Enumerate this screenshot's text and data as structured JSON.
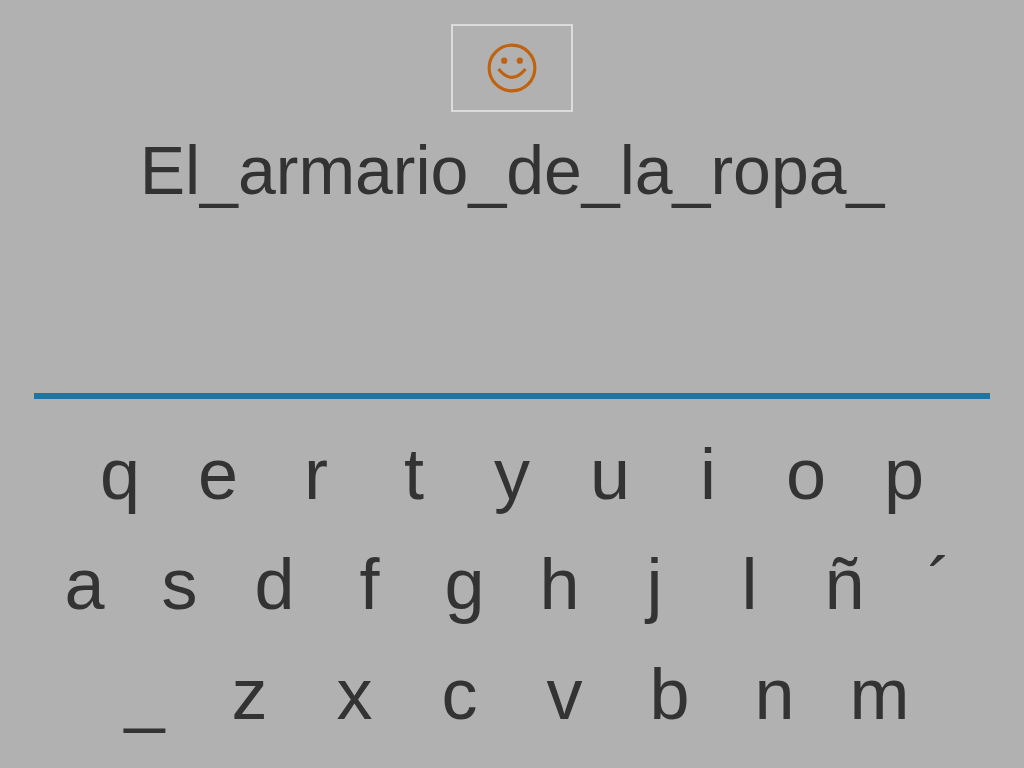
{
  "phrase": "El_armario_de_la_ropa_",
  "keyboard": {
    "rows": [
      [
        "q",
        "e",
        "r",
        "t",
        "y",
        "u",
        "i",
        "o",
        "p"
      ],
      [
        "a",
        "s",
        "d",
        "f",
        "g",
        "h",
        "j",
        "l",
        "ñ",
        "´"
      ],
      [
        "_",
        "z",
        "x",
        "c",
        "v",
        "b",
        "n",
        "m"
      ]
    ]
  }
}
